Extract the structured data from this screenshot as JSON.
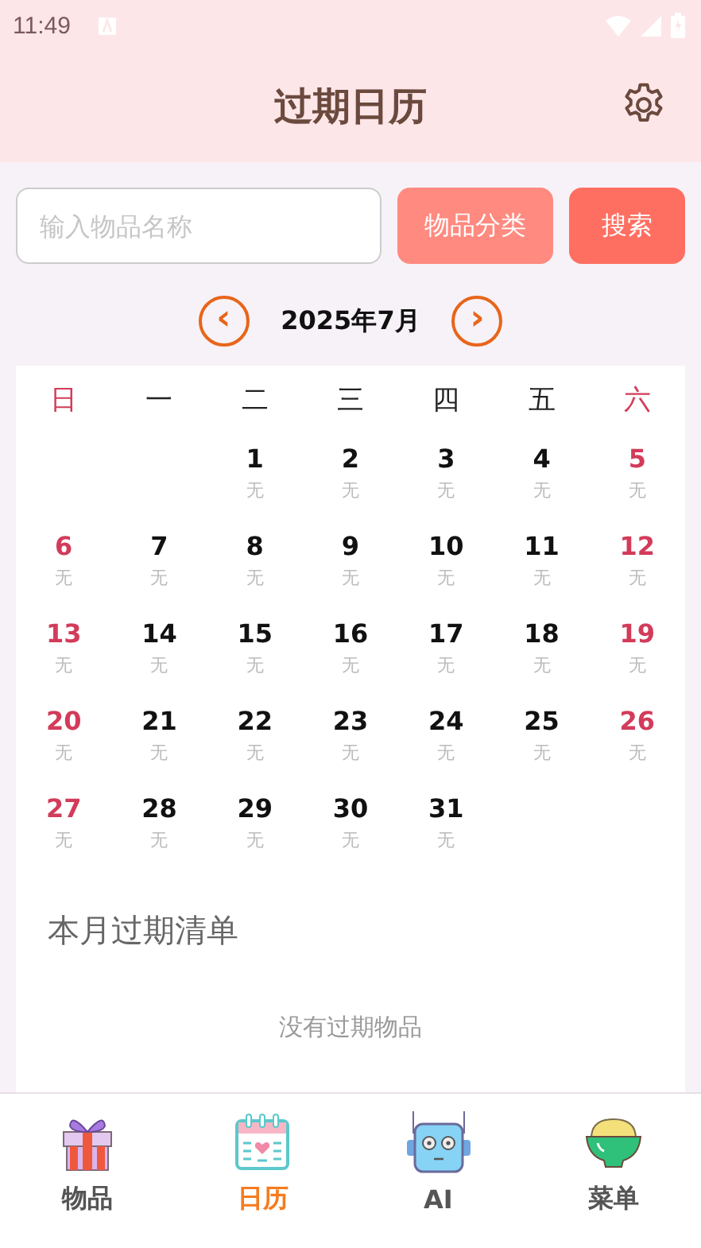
{
  "status_bar": {
    "time": "11:49"
  },
  "header": {
    "title": "过期日历"
  },
  "search": {
    "placeholder": "输入物品名称",
    "buttons": [
      "物品分类",
      "搜索"
    ]
  },
  "month_nav": {
    "prev": "‹",
    "label": "2025年7月",
    "next": "›"
  },
  "calendar": {
    "weekdays": [
      "日",
      "一",
      "二",
      "三",
      "四",
      "五",
      "六"
    ],
    "weeks": [
      {
        "kind": "shifted",
        "days": [
          {
            "day": "1",
            "note": "无"
          },
          {
            "day": "2",
            "note": "无"
          },
          {
            "day": "3",
            "note": "无"
          },
          {
            "day": "4",
            "note": "无"
          },
          {
            "day": "5",
            "note": "无"
          }
        ]
      },
      {
        "kind": "plain",
        "days": [
          {
            "day": "6",
            "note": "无"
          },
          {
            "day": "7",
            "note": "无"
          },
          {
            "day": "8",
            "note": "无"
          },
          {
            "day": "9",
            "note": "无"
          },
          {
            "day": "10",
            "note": "无"
          },
          {
            "day": "11",
            "note": "无"
          },
          {
            "day": "12",
            "note": "无"
          }
        ]
      },
      {
        "kind": "plain",
        "days": [
          {
            "day": "13",
            "note": "无"
          },
          {
            "day": "14",
            "note": "无"
          },
          {
            "day": "15",
            "note": "无"
          },
          {
            "day": "16",
            "note": "无"
          },
          {
            "day": "17",
            "note": "无"
          },
          {
            "day": "18",
            "note": "无"
          },
          {
            "day": "19",
            "note": "无"
          }
        ]
      },
      {
        "kind": "plain",
        "days": [
          {
            "day": "20",
            "note": "无"
          },
          {
            "day": "21",
            "note": "无"
          },
          {
            "day": "22",
            "note": "无"
          },
          {
            "day": "23",
            "note": "无"
          },
          {
            "day": "24",
            "note": "无"
          },
          {
            "day": "25",
            "note": "无"
          },
          {
            "day": "26",
            "note": "无"
          }
        ]
      },
      {
        "kind": "plain",
        "days": [
          {
            "day": "27",
            "note": "无"
          },
          {
            "day": "28",
            "note": "无"
          },
          {
            "day": "29",
            "note": "无"
          },
          {
            "day": "30",
            "note": "无"
          },
          {
            "day": "31",
            "note": "无"
          }
        ]
      }
    ]
  },
  "expired_list": {
    "title": "本月过期清单",
    "empty_text": "没有过期物品"
  },
  "tabs": [
    {
      "label": "物品",
      "kind": "gift",
      "selected": false
    },
    {
      "label": "日历",
      "kind": "calendar",
      "selected": true
    },
    {
      "label": "AI",
      "kind": "robot",
      "selected": false
    },
    {
      "label": "菜单",
      "kind": "bowl",
      "selected": false
    }
  ]
}
